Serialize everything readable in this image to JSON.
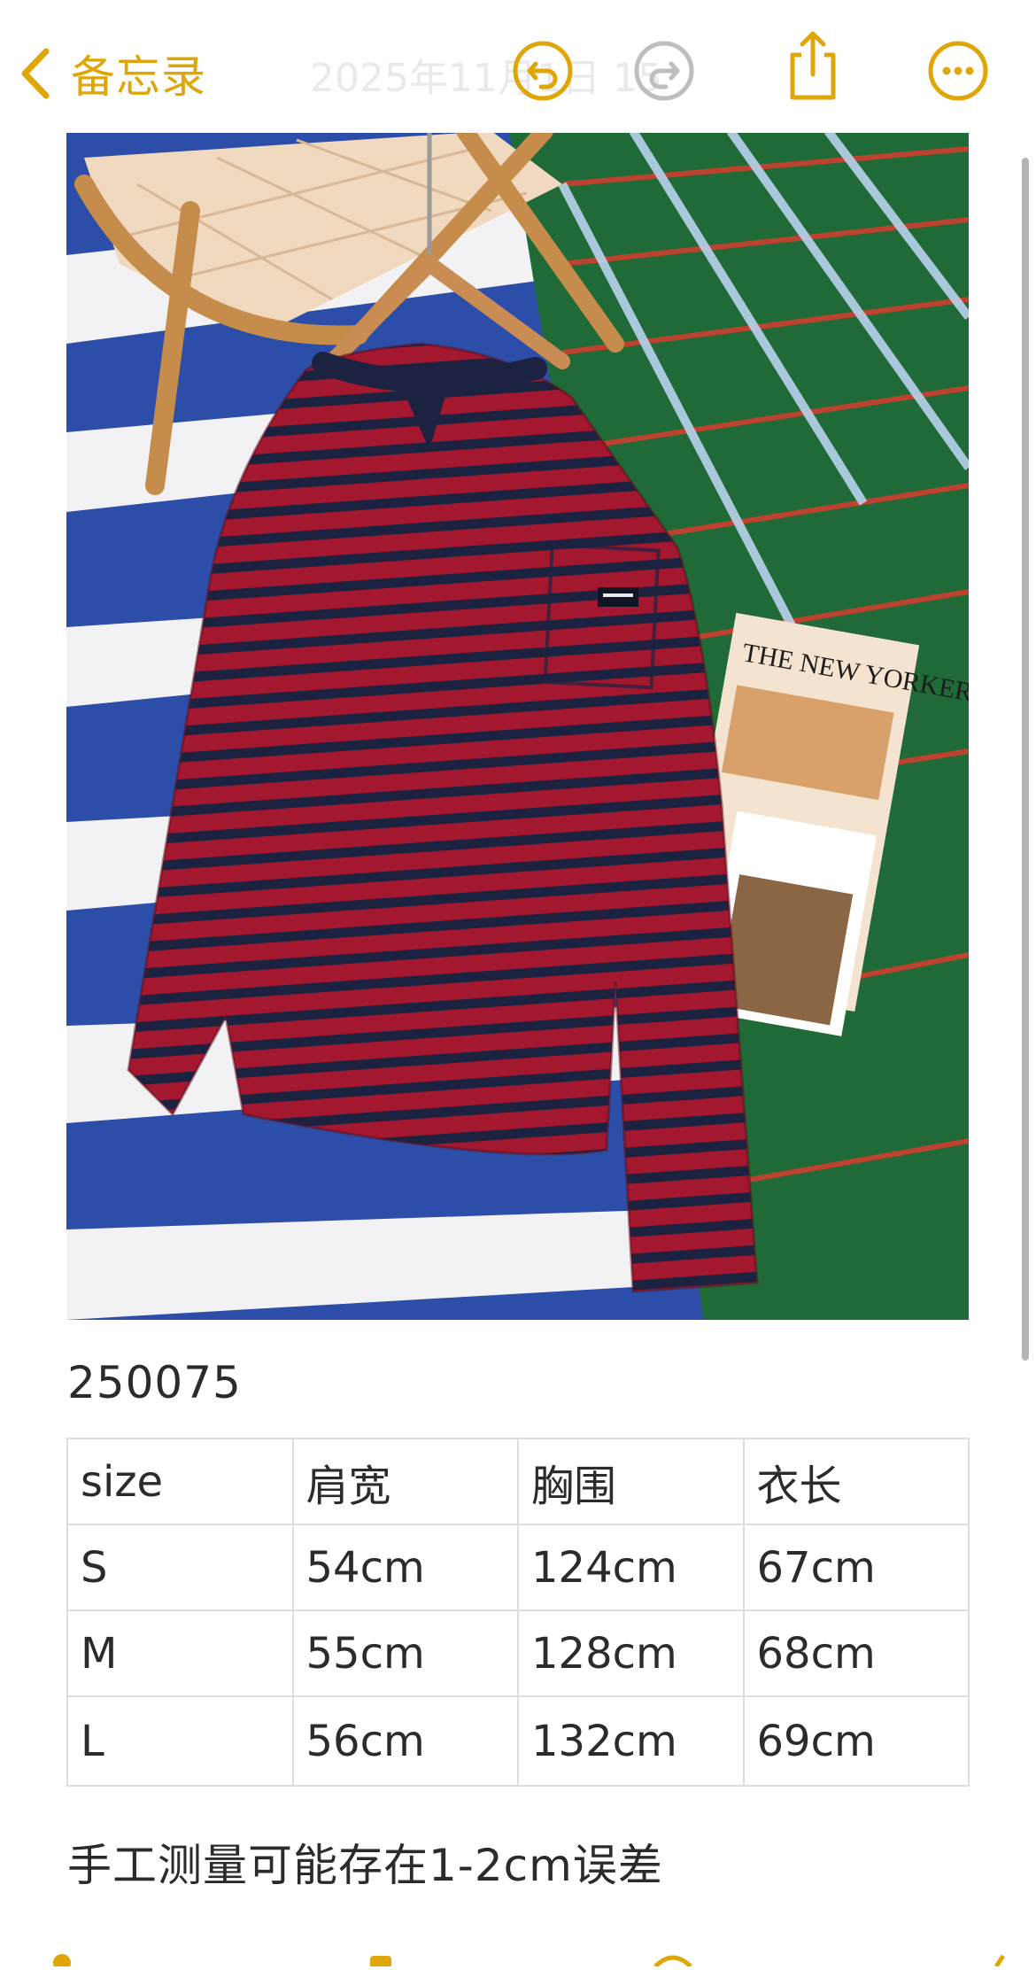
{
  "nav": {
    "back_label": "备忘录",
    "date_text": "2025年11月1日 15",
    "accent_color": "#e0a608",
    "icons": [
      "chevron-left-icon",
      "undo-icon",
      "redo-icon",
      "share-icon",
      "more-icon"
    ]
  },
  "note": {
    "product_code": "250075",
    "table": {
      "headers": [
        "size",
        "肩宽",
        "胸围",
        "衣长"
      ],
      "rows": [
        [
          "S",
          "54cm",
          "124cm",
          "67cm"
        ],
        [
          "M",
          "55cm",
          "128cm",
          "68cm"
        ],
        [
          "L",
          "56cm",
          "132cm",
          "69cm"
        ]
      ]
    },
    "footnote": "手工测量可能存在1-2cm误差"
  },
  "photo": {
    "magazine_title": "THE NEW YORKER"
  }
}
